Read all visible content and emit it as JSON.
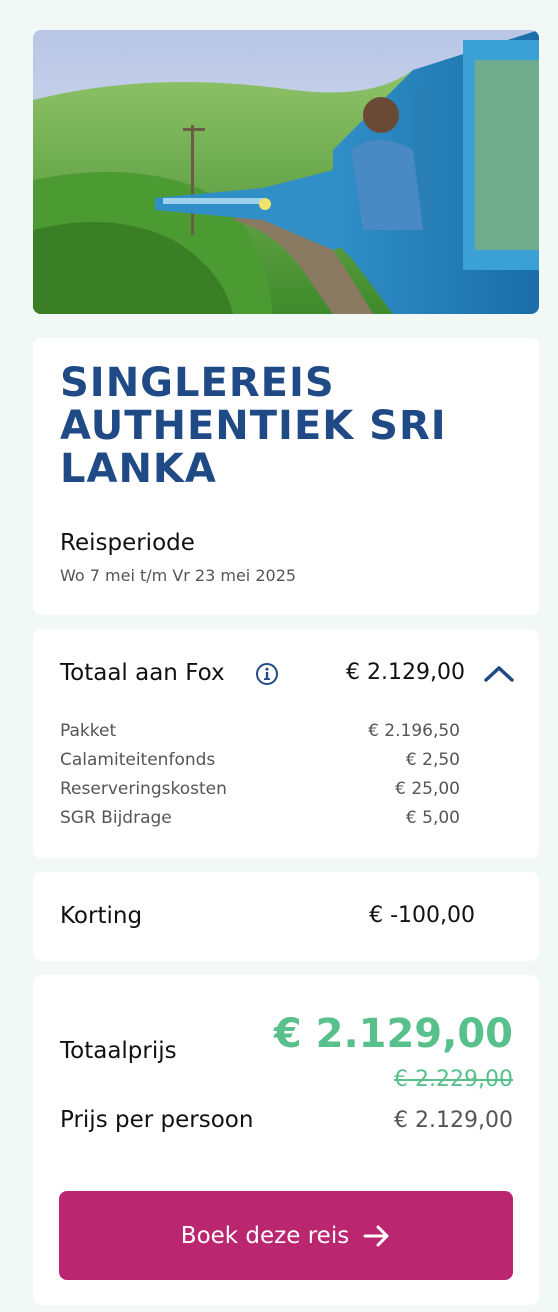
{
  "hero": {
    "image_icon": "train-photo"
  },
  "trip": {
    "title": "SINGLEREIS AUTHENTIEK SRI LANKA",
    "period_label": "Reisperiode",
    "period_value": "Wo 7 mei t/m Vr 23 mei 2025"
  },
  "fox": {
    "label": "Totaal aan Fox",
    "amount": "€ 2.129,00",
    "info_icon": "info-icon",
    "toggle_icon": "chevron-up-icon",
    "items": [
      {
        "label": "Pakket",
        "value": "€ 2.196,50"
      },
      {
        "label": "Calamiteitenfonds",
        "value": "€ 2,50"
      },
      {
        "label": "Reserveringskosten",
        "value": "€ 25,00"
      },
      {
        "label": "SGR Bijdrage",
        "value": "€ 5,00"
      }
    ]
  },
  "korting": {
    "label": "Korting",
    "amount": "€ -100,00"
  },
  "total": {
    "label": "Totaalprijs",
    "amount": "€ 2.129,00",
    "old_amount": "€ 2.229,00",
    "per_person_label": "Prijs per persoon",
    "per_person_amount": "€ 2.129,00"
  },
  "book_button": {
    "label": "Boek deze reis",
    "icon": "arrow-right-icon"
  },
  "colors": {
    "title": "#1f4a85",
    "accent_green": "#58c08a",
    "button": "#ba2670",
    "background": "#f1f8f5"
  }
}
